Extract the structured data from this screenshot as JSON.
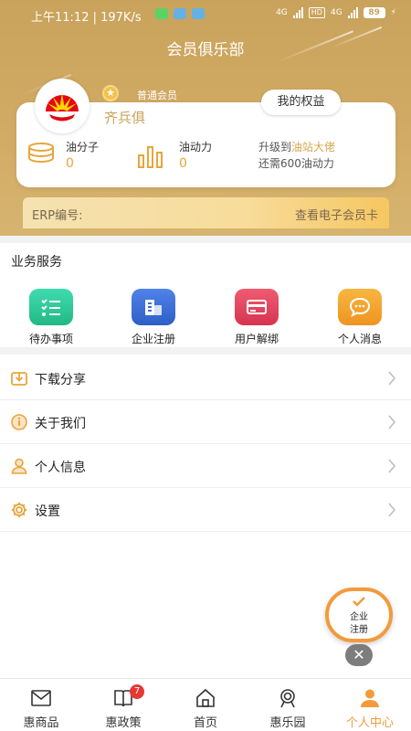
{
  "status_bar": {
    "time": "上午11:12 | 197K/s",
    "network1": "4G",
    "hd": "HD",
    "network2": "4G",
    "battery": "89"
  },
  "header": {
    "title": "会员俱乐部"
  },
  "member": {
    "level": "普通会员",
    "name": "齐兵俱",
    "rights_button": "我的权益",
    "stats": [
      {
        "label": "油分子",
        "value": "0"
      },
      {
        "label": "油动力",
        "value": "0"
      }
    ],
    "upgrade_prefix": "升级到",
    "upgrade_target": "油站大佬",
    "upgrade_need": "还需600油动力"
  },
  "erp": {
    "label": "ERP编号:",
    "link": "查看电子会员卡"
  },
  "services": {
    "title": "业务服务",
    "items": [
      {
        "label": "待办事项",
        "icon": "todo-list-icon",
        "color": "#2ec99a"
      },
      {
        "label": "企业注册",
        "icon": "building-icon",
        "color": "#3b6fd6"
      },
      {
        "label": "用户解绑",
        "icon": "card-icon",
        "color": "#e0435e"
      },
      {
        "label": "个人消息",
        "icon": "chat-bubble-icon",
        "color": "#f2a12f"
      }
    ]
  },
  "menu": [
    {
      "label": "下载分享",
      "icon": "download-icon"
    },
    {
      "label": "关于我们",
      "icon": "info-icon"
    },
    {
      "label": "个人信息",
      "icon": "person-icon"
    },
    {
      "label": "设置",
      "icon": "gear-icon"
    }
  ],
  "floating": {
    "line1": "企业",
    "line2": "注册"
  },
  "bottom_nav": {
    "items": [
      {
        "label": "惠商品",
        "icon": "mail-icon"
      },
      {
        "label": "惠政策",
        "icon": "book-icon",
        "badge": "7"
      },
      {
        "label": "首页",
        "icon": "home-icon"
      },
      {
        "label": "惠乐园",
        "icon": "radar-icon"
      },
      {
        "label": "个人中心",
        "icon": "user-icon"
      }
    ],
    "active_color": "#f39a3c"
  }
}
